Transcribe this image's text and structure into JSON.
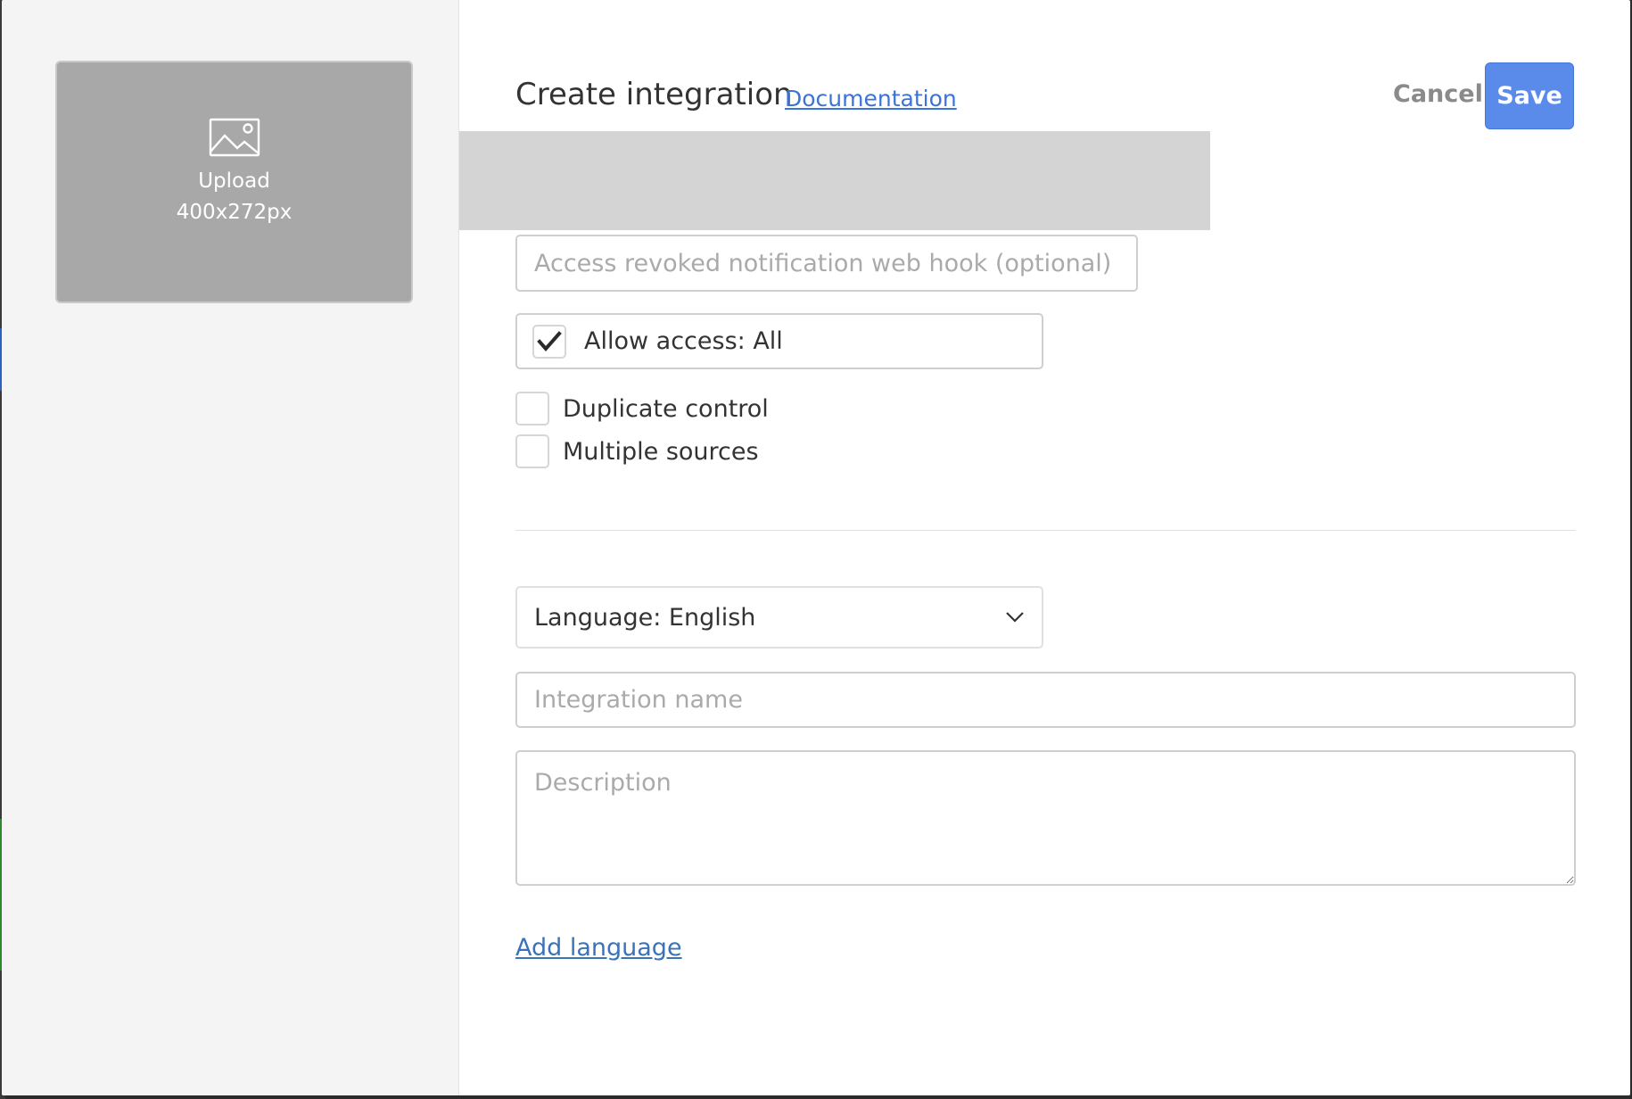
{
  "upload": {
    "line1": "Upload",
    "line2": "400x272px",
    "icon": "image-icon"
  },
  "header": {
    "title": "Create integration",
    "doc_link": "Documentation",
    "cancel_label": "Cancel",
    "save_label": "Save"
  },
  "form": {
    "webhook_placeholder": "Access revoked notification web hook (optional)",
    "allow_access_label": "Allow access: All",
    "allow_access_checked": true,
    "duplicate_control_label": "Duplicate control",
    "multiple_sources_label": "Multiple sources",
    "language_label": "Language: English",
    "integration_name_placeholder": "Integration name",
    "description_placeholder": "Description",
    "add_language_label": "Add language"
  },
  "colors": {
    "primary": "#5a8bea",
    "link": "#3b73d8",
    "upload_bg": "#a8a8a8",
    "panel_bg": "#f4f4f4"
  }
}
